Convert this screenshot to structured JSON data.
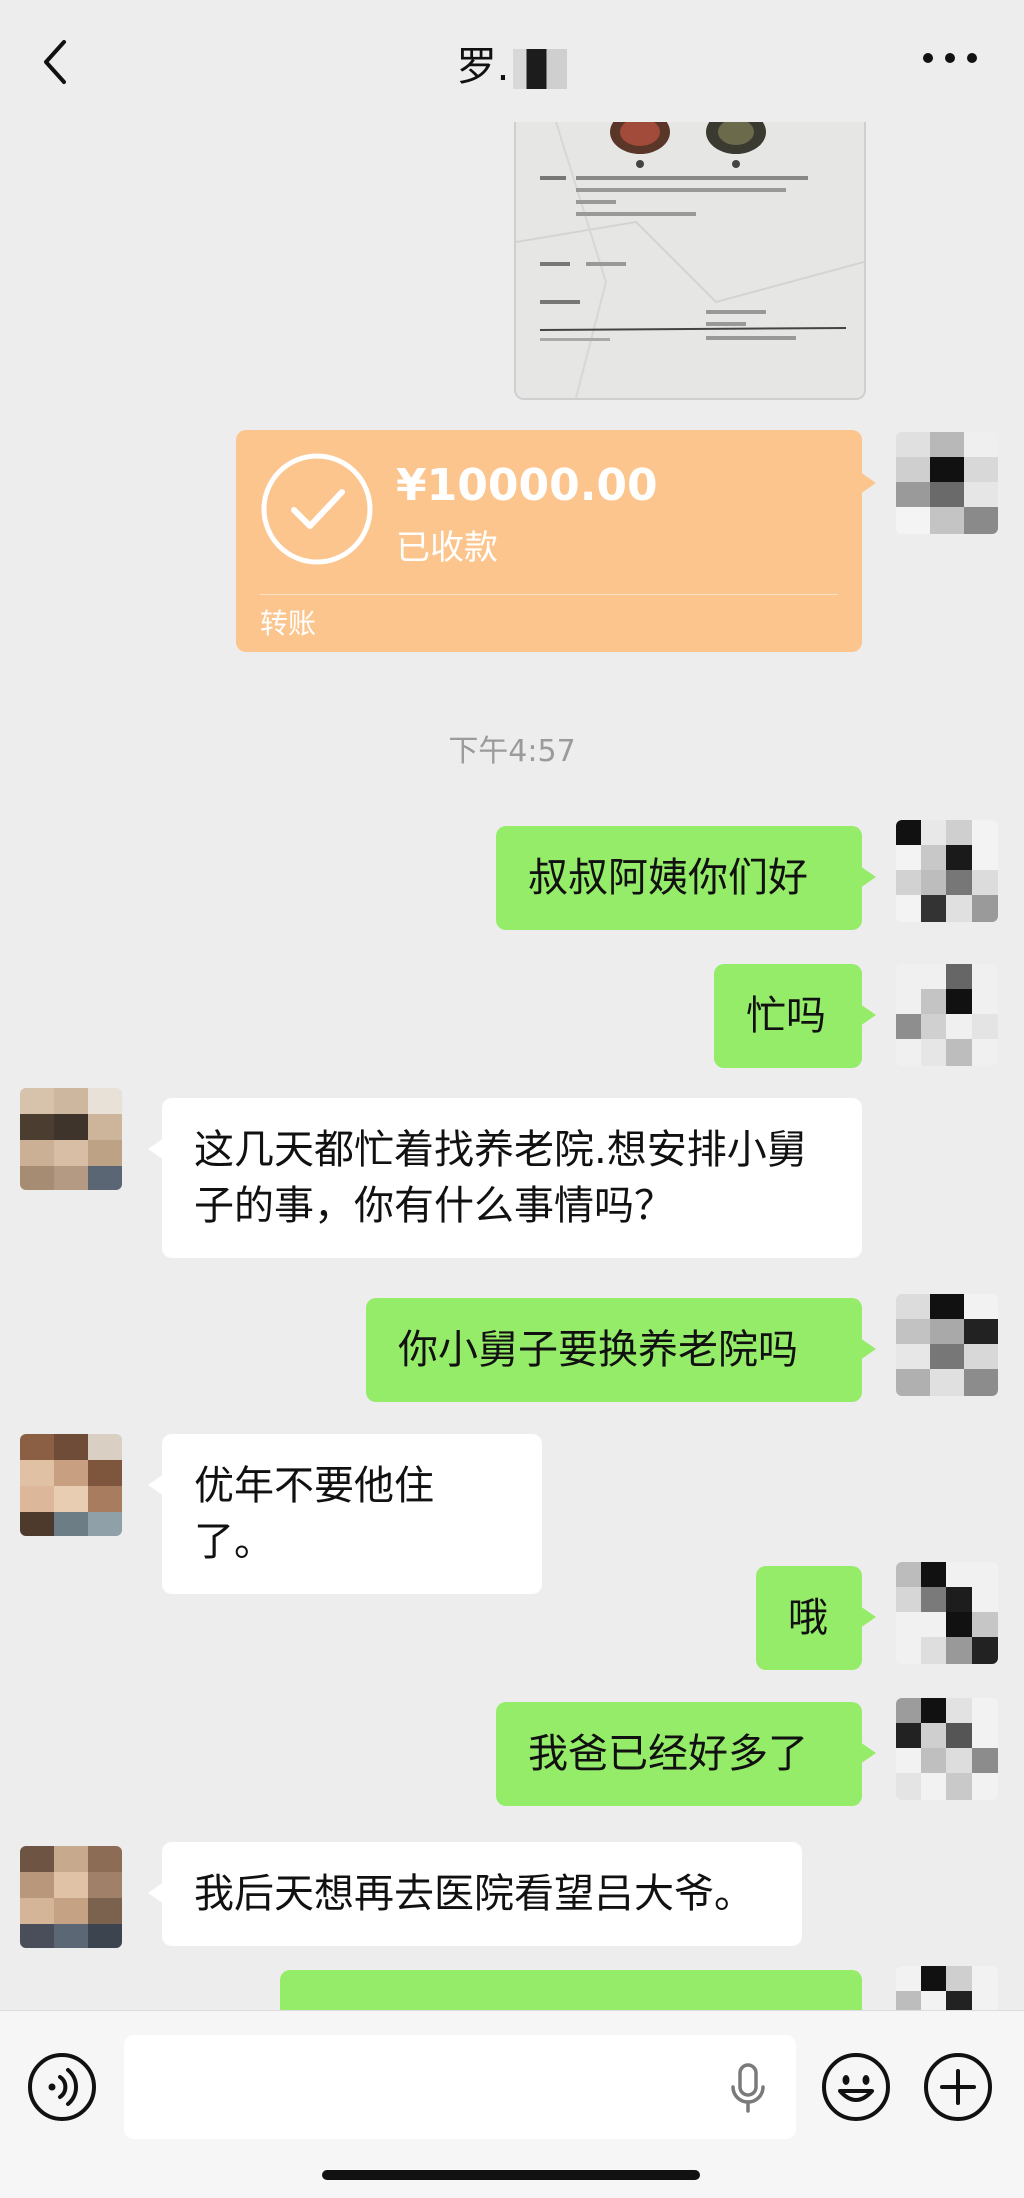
{
  "header": {
    "title": "罗."
  },
  "transfer": {
    "amount": "¥10000.00",
    "status": "已收款",
    "type": "转账"
  },
  "timestamp": "下午4:57",
  "messages": [
    {
      "side": "me",
      "text": "叔叔阿姨你们好"
    },
    {
      "side": "me",
      "text": "忙吗"
    },
    {
      "side": "other",
      "text": "这几天都忙着找养老院.想安排小舅子的事，你有什么事情吗？"
    },
    {
      "side": "me",
      "text": "你小舅子要换养老院吗"
    },
    {
      "side": "other",
      "text": "优年不要他住了。"
    },
    {
      "side": "me",
      "text": "哦"
    },
    {
      "side": "me",
      "text": "我爸已经好多了"
    },
    {
      "side": "other",
      "text": "我后天想再去医院看望吕大爷。"
    }
  ],
  "colors": {
    "my_bubble": "#95ec69",
    "other_bubble": "#ffffff",
    "transfer": "#fcc58d",
    "background": "#ededed"
  },
  "icons": [
    "back-icon",
    "more-icon",
    "voice-icon",
    "microphone-icon",
    "emoji-icon",
    "plus-icon",
    "check-circle-icon"
  ]
}
